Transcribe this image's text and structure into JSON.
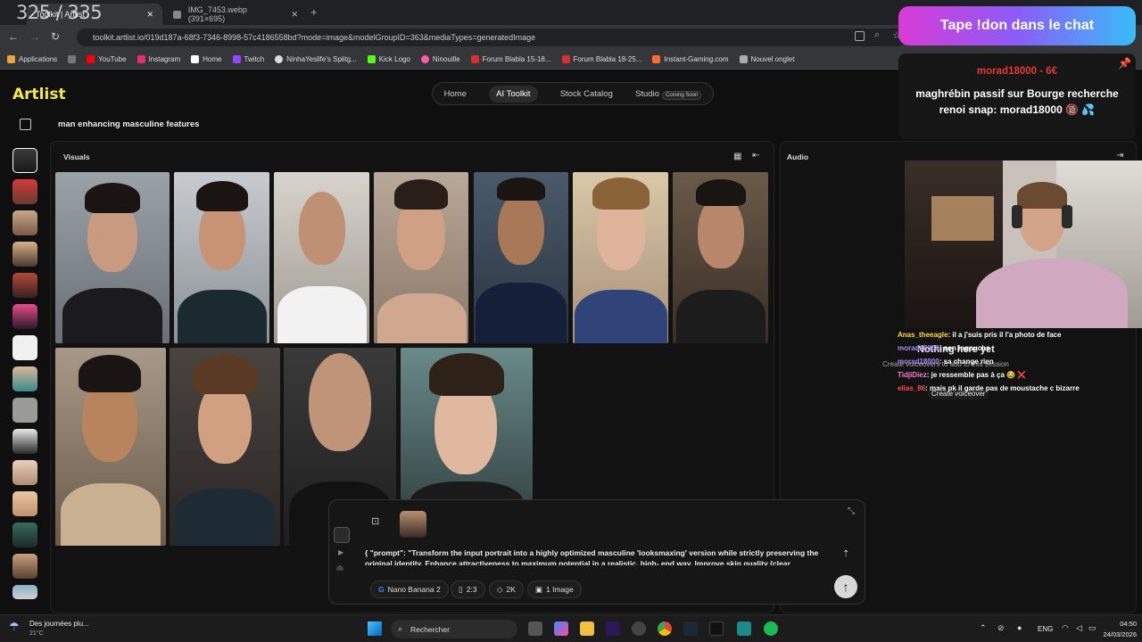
{
  "browser": {
    "counter": "325 / 335",
    "tabs": [
      {
        "label": "Toolkit | Artlist"
      },
      {
        "label": "IMG_7453.webp (391×695)"
      }
    ],
    "url": "toolkit.artlist.io/019d187a-68f3-7346-8998-57c4186558bd?mode=image&modelGroupID=363&mediaTypes=generatedImage",
    "bookmarks": [
      {
        "label": "Applications",
        "color": "#e8a33c"
      },
      {
        "label": "YouTube",
        "color": "#ff0000"
      },
      {
        "label": "Instagram",
        "color": "#e1306c"
      },
      {
        "label": "Home",
        "color": "#ffffff"
      },
      {
        "label": "Twitch",
        "color": "#9146ff"
      },
      {
        "label": "NinhaYeslife's Splitg...",
        "color": "#dddddd"
      },
      {
        "label": "Kick Logo",
        "color": "#53fc18"
      },
      {
        "label": "Ninouille",
        "color": "#ff5ca8"
      },
      {
        "label": "Forum Blabla 15-18...",
        "color": "#d32f2f"
      },
      {
        "label": "Forum Blabla 18-25...",
        "color": "#d32f2f"
      },
      {
        "label": "Instant-Gaming.com",
        "color": "#ff6b2b"
      },
      {
        "label": "Nouvel onglet",
        "color": "#aaaaaa"
      }
    ]
  },
  "app": {
    "logo": "Artlist",
    "nav": [
      {
        "label": "Home"
      },
      {
        "label": "AI Toolkit"
      },
      {
        "label": "Stock Catalog"
      },
      {
        "label": "Studio"
      }
    ],
    "coming_soon": "Coming Soon",
    "session_title": "man enhancing masculine features",
    "visuals_label": "Visuals",
    "audio_label": "Audio",
    "audio_empty": "Nothing here yet",
    "audio_hint": "Create voiceovers to add to this session",
    "create_voiceover": "Create voiceover",
    "prompt_text": "{ \"prompt\": \"Transform the input portrait into a highly optimized masculine 'looksmaxing' version while strictly preserving the original identity. Enhance attractiveness to maximum potential in a realistic, high- end way. Improve skin quality (clear",
    "model": "Nano Banana 2",
    "ratio": "2:3",
    "resolution": "2K",
    "count": "1 Image"
  },
  "stream": {
    "don_banner": "Tape !don dans le chat",
    "donation_header": "morad18000 - 6€",
    "donation_message": "maghrébin passif sur Bourge recherche renoi snap: morad18000 🔞 💦",
    "chat": [
      {
        "user": "Anas_theeagle",
        "user_color": "#ffd84d",
        "msg": "il a j'suis pris il l'a photo de face"
      },
      {
        "user": "morad18000",
        "user_color": "#a78bfa",
        "msg": "son ingouche"
      },
      {
        "user": "morad18000",
        "user_color": "#a78bfa",
        "msg": "sa change rien"
      },
      {
        "user": "TidjiDiez",
        "user_color": "#ff7ad9",
        "msg": "je ressemble pas à ça 😂 ❌"
      },
      {
        "user": "elias_86",
        "user_color": "#ff4d4d",
        "msg": "mais pk il garde pas de moustache c bizarre"
      }
    ]
  },
  "taskbar": {
    "weather": "Des journées plu...",
    "temp": "21°C",
    "search": "Rechercher",
    "lang": "ENG",
    "time": "04:50",
    "date": "24/03/2026"
  }
}
